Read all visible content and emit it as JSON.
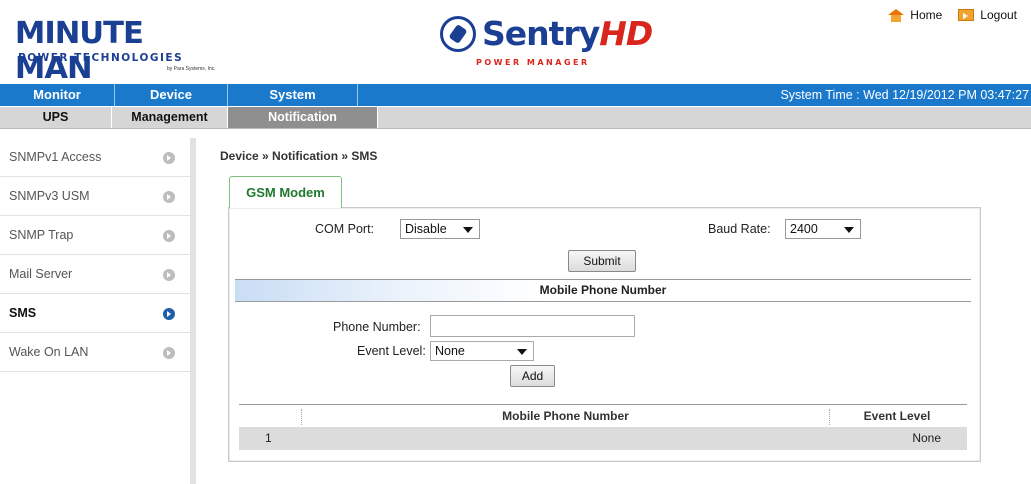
{
  "header": {
    "brand_main": "MINUTE MAN",
    "brand_sub": "POWER TECHNOLOGIES",
    "brand_tiny": "by Para Systems, Inc.",
    "product_name_a": "Sentry",
    "product_name_b": "HD",
    "product_sub": "POWER MANAGER",
    "home_label": "Home",
    "logout_label": "Logout"
  },
  "main_nav": {
    "items": [
      {
        "label": "Monitor"
      },
      {
        "label": "Device"
      },
      {
        "label": "System"
      }
    ],
    "system_time": "System Time : Wed 12/19/2012 PM 03:47:27"
  },
  "sub_nav": {
    "items": [
      {
        "label": "UPS"
      },
      {
        "label": "Management"
      },
      {
        "label": "Notification"
      }
    ]
  },
  "sidebar": {
    "items": [
      {
        "label": "SNMPv1 Access"
      },
      {
        "label": "SNMPv3 USM"
      },
      {
        "label": "SNMP Trap"
      },
      {
        "label": "Mail Server"
      },
      {
        "label": "SMS"
      },
      {
        "label": "Wake On LAN"
      }
    ]
  },
  "content": {
    "breadcrumb": "Device » Notification » SMS",
    "tab_label": "GSM Modem",
    "com_port_label": "COM Port:",
    "com_port_value": "Disable",
    "baud_rate_label": "Baud Rate:",
    "baud_rate_value": "2400",
    "submit_label": "Submit",
    "section_title": "Mobile Phone Number",
    "phone_label": "Phone Number:",
    "phone_value": "",
    "event_level_label": "Event Level:",
    "event_level_value": "None",
    "add_label": "Add",
    "table": {
      "columns": [
        "",
        "Mobile Phone Number",
        "Event Level"
      ],
      "rows": [
        {
          "index": "1",
          "number": "",
          "level": "None"
        }
      ]
    }
  }
}
